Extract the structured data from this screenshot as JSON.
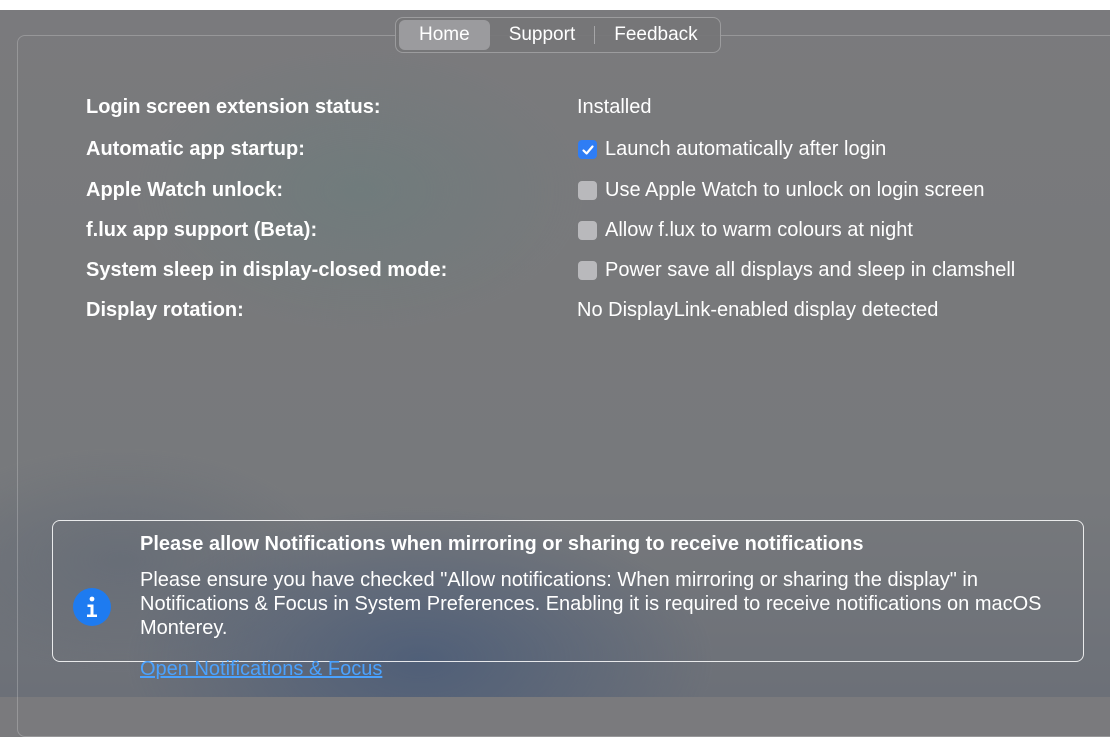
{
  "tabs": [
    {
      "label": "Home",
      "selected": true
    },
    {
      "label": "Support",
      "selected": false
    },
    {
      "label": "Feedback",
      "selected": false
    }
  ],
  "settings": [
    {
      "label": "Login screen extension status:",
      "type": "text",
      "value": "Installed"
    },
    {
      "label": "Automatic app startup:",
      "type": "checkbox",
      "checked": true,
      "value": "Launch automatically after login"
    },
    {
      "label": "Apple Watch unlock:",
      "type": "checkbox",
      "checked": false,
      "value": "Use Apple Watch to unlock on login screen"
    },
    {
      "label": "f.lux app support (Beta):",
      "type": "checkbox",
      "checked": false,
      "value": "Allow f.lux to warm colours at night"
    },
    {
      "label": "System sleep in display-closed mode:",
      "type": "checkbox",
      "checked": false,
      "value": "Power save all displays and sleep in clamshell"
    },
    {
      "label": "Display rotation:",
      "type": "text",
      "value": "No DisplayLink-enabled display detected"
    }
  ],
  "notice": {
    "icon": "info-icon",
    "title": "Please allow Notifications when mirroring or sharing to receive notifications",
    "body": "Please ensure you have checked \"Allow notifications: When mirroring or sharing the display\" in Notifications & Focus in System Preferences. Enabling it is required to receive notifications on macOS Monterey.",
    "link": "Open Notifications & Focus"
  },
  "colors": {
    "accent": "#2f7df4",
    "link": "#4aa2ff",
    "info_icon": "#1e7bf0"
  }
}
